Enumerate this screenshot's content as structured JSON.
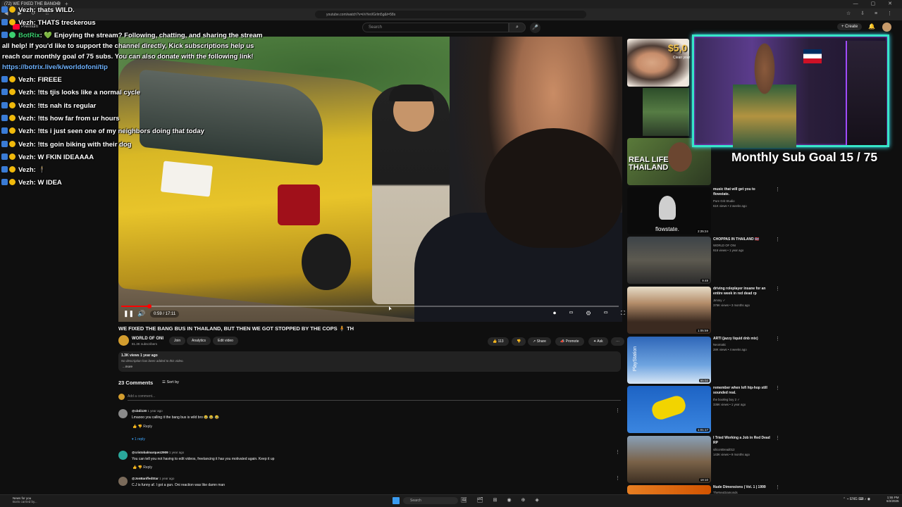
{
  "browser": {
    "tab_title": "(72) WE FIXED THE BANG BUS...",
    "url": "youtube.com/watch?v=i/vYeri/Grlm5g&t=58s",
    "new_tab": "+",
    "window_controls": "— ▢ ✕",
    "nav_icons": "◀ ▶ ⟳ ⌂",
    "extension_icons": "☆ ⇩ ≡ ⋮"
  },
  "youtube_header": {
    "logo_label": "Premium",
    "search_placeholder": "Search",
    "create_label": "+ Create"
  },
  "chat": [
    {
      "user": "Vezh",
      "text": ": thats WILD."
    },
    {
      "user": "Vezh",
      "text": ": THATS treckerous"
    },
    {
      "user": "BotRix",
      "text": ": 💚 Enjoying the stream? Following, chatting, and sharing the stream"
    },
    {
      "user": "",
      "text": "all help! If you'd like to support the channel directly, Kick subscriptions help us"
    },
    {
      "user": "",
      "text": "reach our monthly goal of 75 subs. You can also donate with the following link!"
    },
    {
      "user": "",
      "text": "https://botrix.live/k/worldofoni/tip"
    },
    {
      "user": "Vezh",
      "text": ": FIREEE"
    },
    {
      "user": "Vezh",
      "text": ": !tts tjis looks like a normal cycle"
    },
    {
      "user": "Vezh",
      "text": ": !tts nah its regular"
    },
    {
      "user": "Vezh",
      "text": ": !tts how far from ur hours"
    },
    {
      "user": "Vezh",
      "text": ": !tts i just seen one of my neighbors doing that today"
    },
    {
      "user": "Vezh",
      "text": ": !tts goin biking with their dog"
    },
    {
      "user": "Vezh",
      "text": ": W FKIN IDEAAAA"
    },
    {
      "user": "Vezh",
      "text": ":  🕴"
    },
    {
      "user": "Vezh",
      "text": ": W IDEA"
    }
  ],
  "player": {
    "time": "0:59 / 17:11",
    "progress_fraction": 0.057,
    "play_icon": "❚❚",
    "volume_icon": "🔊",
    "right_controls": "⏺ ▭ ⚙ ▭ ⛶"
  },
  "video": {
    "title": "WE FIXED THE BANG BUS IN THAILAND, BUT THEN WE GOT STOPPED BY THE COPS 🧍 TH",
    "channel": "WORLD OF ONI",
    "subs": "81.3K subscribers",
    "join": "Join",
    "analytics": "Analytics",
    "edit_video": "Edit video",
    "likes": "👍 113",
    "dislike": "👎",
    "share": "↗ Share",
    "promote": "📣 Promote",
    "ask": "✦ Ask",
    "more": "⋯",
    "views_line": "1.3K views  1 year ago",
    "description": "No description has been added to this video.",
    "more_link": "...more"
  },
  "comments": {
    "count": "23 Comments",
    "sort": "☰ Sort by",
    "add_placeholder": "Add a comment...",
    "items": [
      {
        "author": "@cbdi130",
        "time": " 1 year ago",
        "text": "Lmaooo you calling it the bang bus is wild bro 😂 😂 😂",
        "actions": "👍   👎   Reply",
        "replies": "▾ 1 reply"
      },
      {
        "author": "@cristobalmarquez2909",
        "time": " 1 year ago",
        "text": "You can tell you not having to edit videos, freelancing it has you motivated again. Keep it up",
        "actions": "👍   👎   Reply"
      },
      {
        "author": "@JonBanffedStar",
        "time": " 1 year ago",
        "text": "C.J is funny af. I got a gun. Oni reaction was like damn man",
        "actions": ""
      }
    ]
  },
  "overlay": {
    "donation": "$5,0",
    "donation_sub": "Clean your",
    "sub_goal": "Monthly Sub Goal 15 / 75"
  },
  "recommendations": [
    {
      "title": "",
      "channel": "",
      "meta": "",
      "duration": "",
      "overlay_text": "REAL LIFE THAILAND"
    },
    {
      "title": "music that will get you to flowstate.",
      "channel": "Pure Grit Studio",
      "meta": "61K views • 2 weeks ago",
      "duration": "2:25:24",
      "overlay_text": "flowstate."
    },
    {
      "title": "CHOPPAS IN THAILAND 🇹🇭",
      "channel": "WORLD OF ONI",
      "meta": "916 views • 1 year ago",
      "duration": "9:48",
      "overlay_text": ""
    },
    {
      "title": "driving roleplayer insane for an entire week in red dead rp",
      "channel": "Jimmy ✓",
      "meta": "376K views • 3 months ago",
      "duration": "1:05:59",
      "overlay_text": ""
    },
    {
      "title": "ARTI (jazzy liquid dnb mix)",
      "channel": "Neomatic",
      "meta": "28K views • 4 weeks ago",
      "duration": "55:02",
      "overlay_text": "PlayStation"
    },
    {
      "title": "remember when lofi hip-hop still sounded real.",
      "channel": "the bootleg boy 2 ✓",
      "meta": "336K views • 1 year ago",
      "duration": "1:01:17",
      "overlay_text": ""
    },
    {
      "title": "I Tried Working a Job in Red Dead RP",
      "channel": "siliconBread012",
      "meta": "143K views • 9 months ago",
      "duration": "18:10",
      "overlay_text": ""
    },
    {
      "title": "Nude Dimensions | Vol. 1 | 1999",
      "channel": "TheNeoDiamonds",
      "meta": "",
      "duration": "",
      "overlay_text": ""
    }
  ],
  "taskbar": {
    "news_title": "News for you",
    "news_sub": "Boris carried by...",
    "search": "Search",
    "icons": "🖼 🗂 ⊞ ◉ ⊕ ◈",
    "tray": "⌃  ⌁  ENG  ⌨ ♪ ◉",
    "time": "1:55 PM",
    "date": "6/2/2025"
  }
}
